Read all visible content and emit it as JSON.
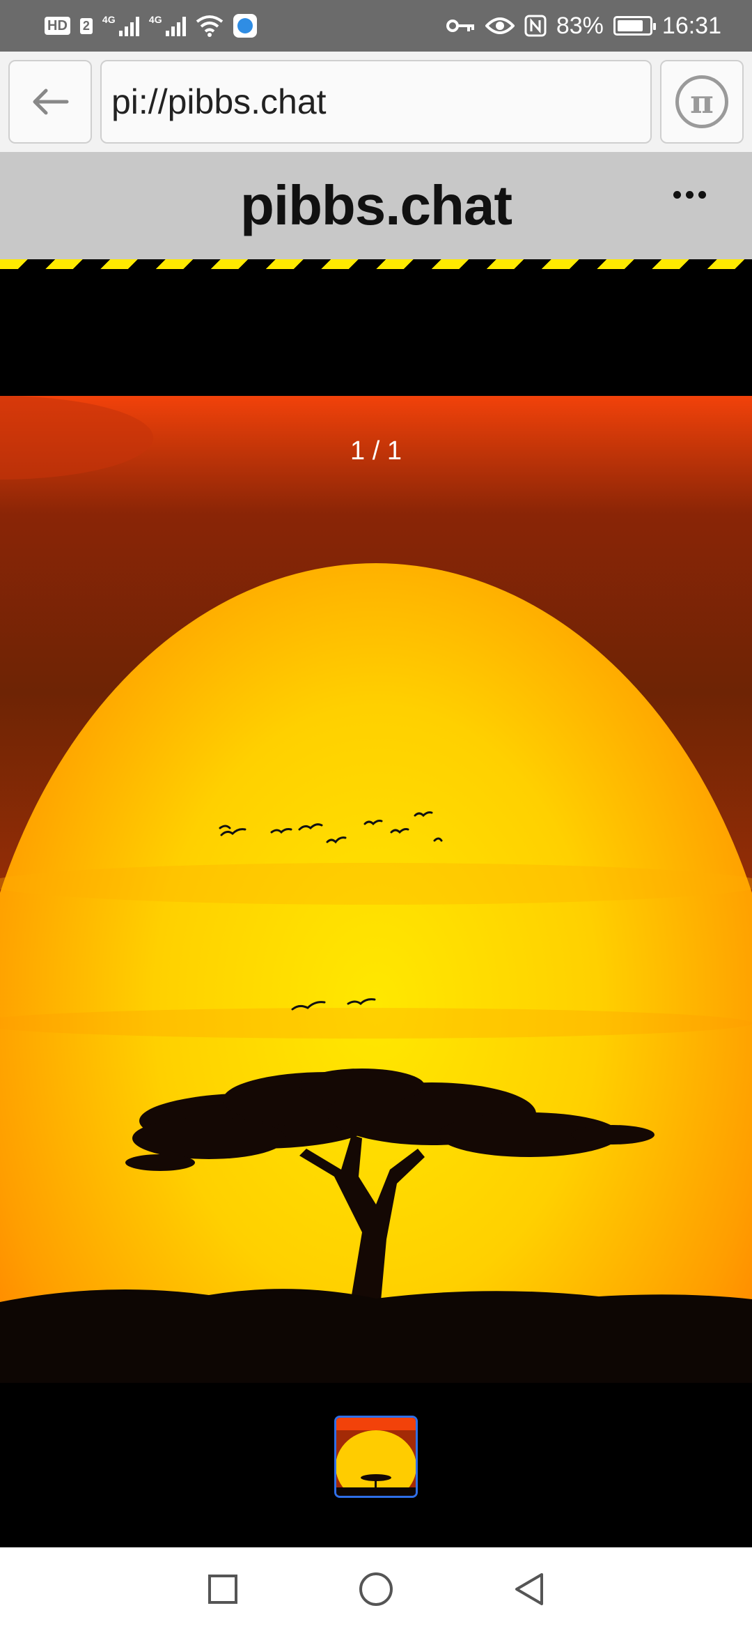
{
  "status_bar": {
    "hd_label": "HD",
    "sim_label": "2",
    "signal1_label": "4G",
    "signal2_label": "4G",
    "battery_percent": "83%",
    "battery_level": 0.83,
    "time": "16:31",
    "icons": [
      "key-icon",
      "eye-icon",
      "nfc-icon",
      "wifi-icon"
    ]
  },
  "browser": {
    "url": "pi://pibbs.chat",
    "back_icon": "arrow-left-icon",
    "pi_icon": "pi-logo-icon",
    "pi_glyph": "π"
  },
  "header": {
    "title": "pibbs.chat",
    "menu_icon": "more-horizontal-icon"
  },
  "viewer": {
    "counter": "1 / 1",
    "image_description_icon": "sunset-photo"
  },
  "colors": {
    "header_bg": "#c8c8c8",
    "hazard_yellow": "#ffea00",
    "thumb_border": "#2f6fe8",
    "status_bar_bg": "#6b6b6b"
  },
  "nav": {
    "recents_icon": "square-icon",
    "home_icon": "circle-icon",
    "back_icon": "triangle-back-icon"
  }
}
